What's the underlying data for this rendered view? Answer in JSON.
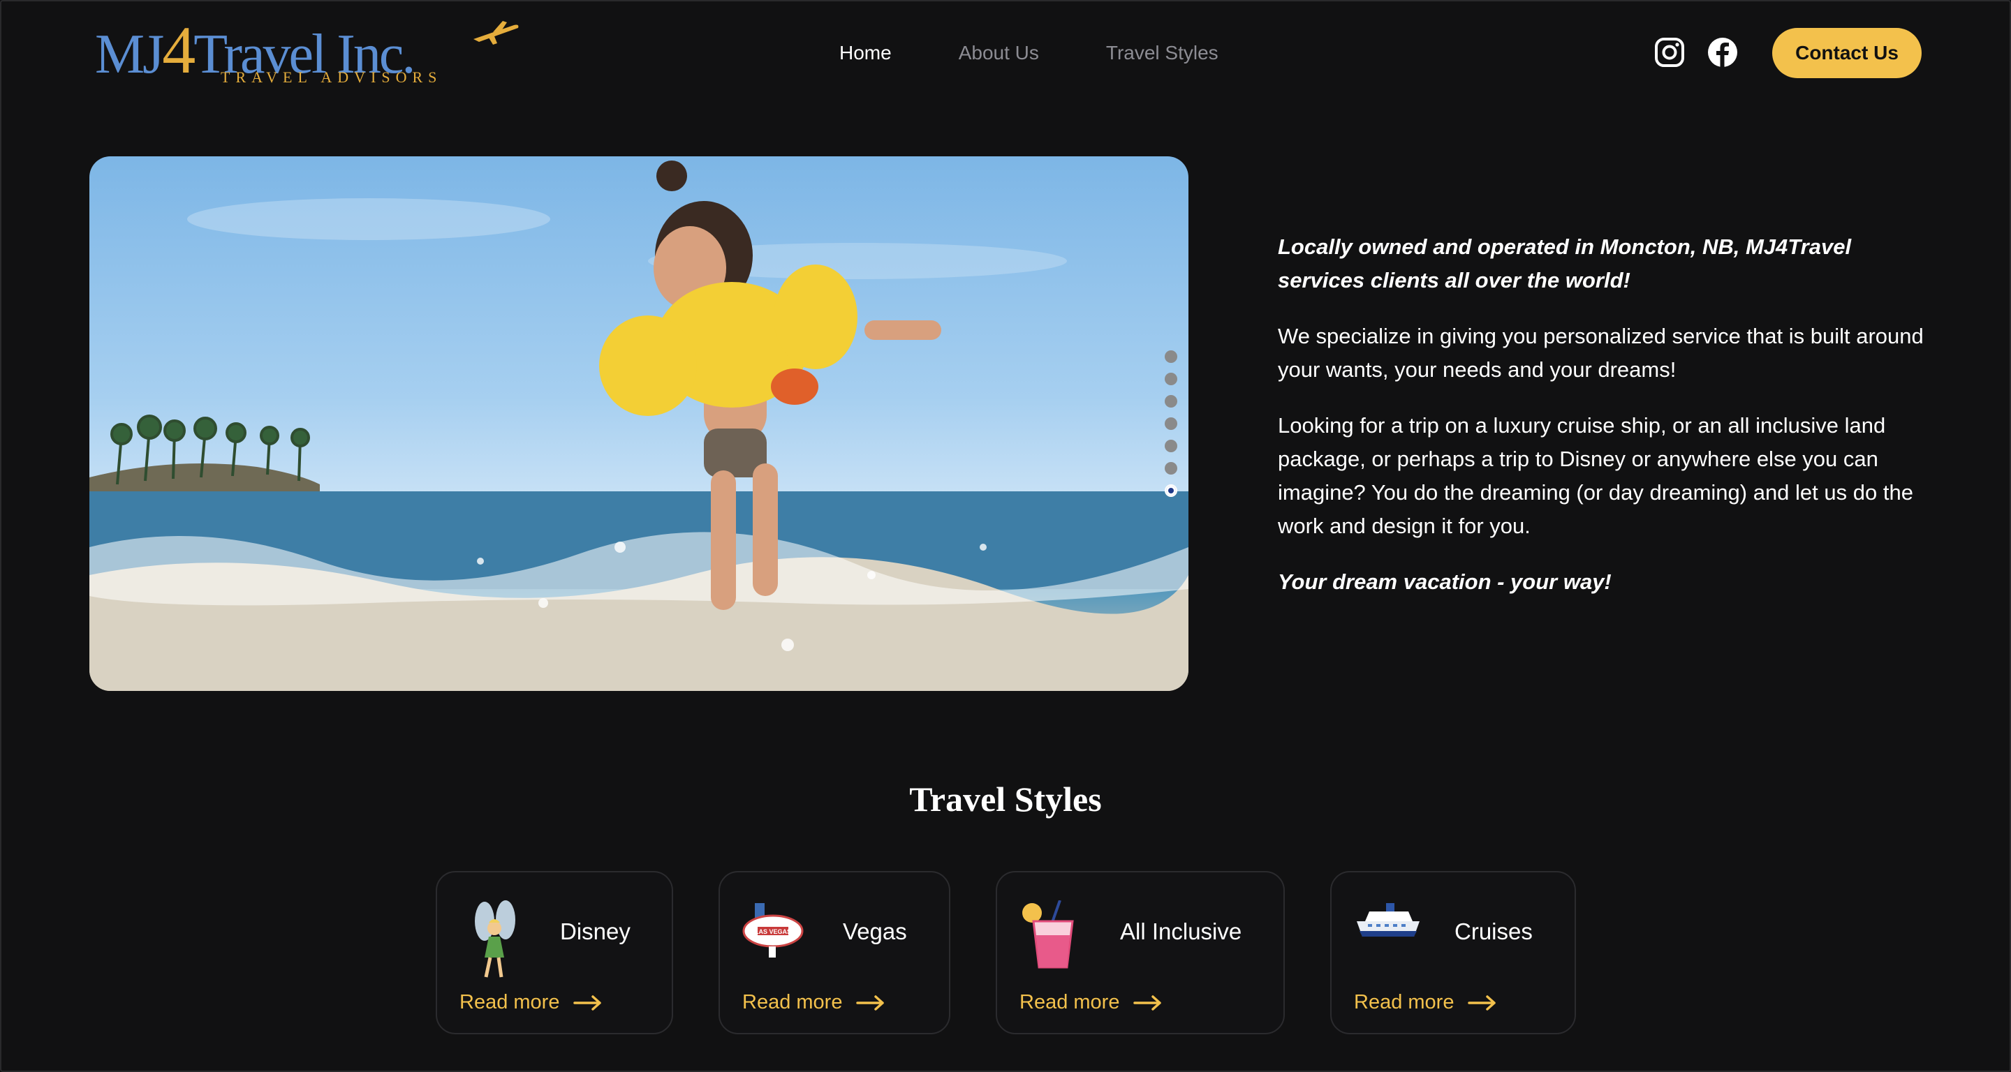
{
  "brand": {
    "name": "MJ",
    "four": "4",
    "name_rest": "Travel Inc.",
    "tagline": "TRAVEL ADVISORS"
  },
  "nav": [
    {
      "label": "Home",
      "active": true
    },
    {
      "label": "About Us",
      "active": false
    },
    {
      "label": "Travel Styles",
      "active": false
    }
  ],
  "social": [
    "instagram-icon",
    "facebook-icon"
  ],
  "contact_label": "Contact Us",
  "colors": {
    "accent": "#f3c14c",
    "brand_blue": "#5b8ed3",
    "background": "#111112"
  },
  "carousel": {
    "slides": 7,
    "active_index": 6
  },
  "intro": {
    "lead": "Locally owned and operated in Moncton, NB, MJ4Travel services clients all over the world!",
    "p1": "We specialize in giving you personalized service that is built around your wants, your needs and your dreams!",
    "p2": "Looking for a trip on a luxury cruise ship, or an all inclusive land package, or perhaps a trip to Disney or anywhere else you can imagine? You do the dreaming (or day dreaming) and let us do the work and design it for you.",
    "closing": "Your dream vacation - your way!"
  },
  "styles": {
    "title": "Travel Styles",
    "cards": [
      {
        "label": "Disney",
        "icon": "fairy-icon",
        "more": "Read more"
      },
      {
        "label": "Vegas",
        "icon": "las-vegas-sign-icon",
        "more": "Read more"
      },
      {
        "label": "All Inclusive",
        "icon": "cocktail-icon",
        "more": "Read more"
      },
      {
        "label": "Cruises",
        "icon": "cruise-ship-icon",
        "more": "Read more"
      }
    ]
  }
}
